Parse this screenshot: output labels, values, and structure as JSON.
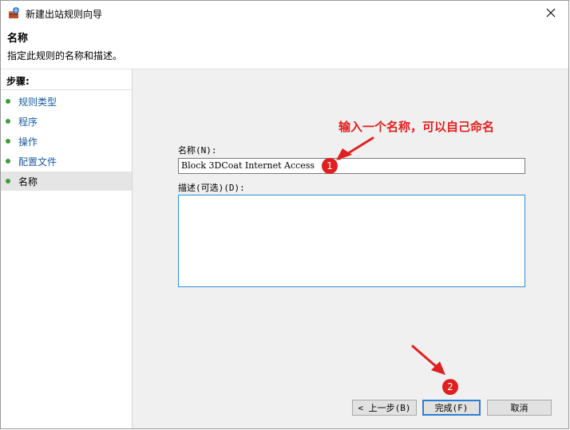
{
  "window": {
    "title": "新建出站规则向导",
    "icon": "firewall-app-icon",
    "close_icon": "close-icon"
  },
  "header": {
    "title": "名称",
    "description": "指定此规则的名称和描述。"
  },
  "sidebar": {
    "heading": "步骤:",
    "items": [
      {
        "label": "规则类型",
        "current": false
      },
      {
        "label": "程序",
        "current": false
      },
      {
        "label": "操作",
        "current": false
      },
      {
        "label": "配置文件",
        "current": false
      },
      {
        "label": "名称",
        "current": true
      }
    ]
  },
  "form": {
    "name_label": "名称(N):",
    "name_value": "Block 3DCoat Internet Access",
    "desc_label": "描述(可选)(D):",
    "desc_value": ""
  },
  "buttons": {
    "back": "< 上一步(B)",
    "finish": "完成(F)",
    "cancel": "取消"
  },
  "annotations": {
    "hint": "输入一个名称，可以自己命名",
    "badge1": "1",
    "badge2": "2"
  },
  "colors": {
    "annotation": "#e02020",
    "step_dot": "#3a9d3a",
    "link": "#1b5b9e",
    "focus": "#2a7fd4"
  }
}
